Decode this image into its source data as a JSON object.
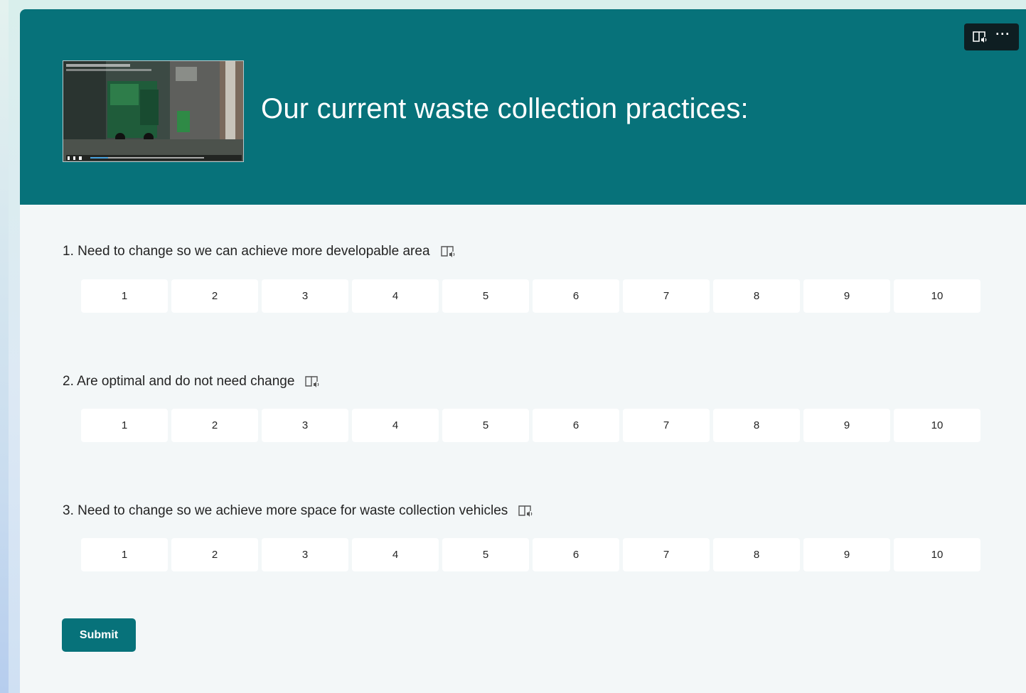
{
  "header": {
    "title": "Our current waste collection practices:",
    "background_color": "#07727a",
    "thumbnail_icon": "video-thumbnail",
    "toolbar": {
      "reader_icon": "immersive-reader-icon",
      "more_label": "···"
    }
  },
  "questions": [
    {
      "label": "1. Need to change so we can achieve more developable area",
      "scale": [
        "1",
        "2",
        "3",
        "4",
        "5",
        "6",
        "7",
        "8",
        "9",
        "10"
      ]
    },
    {
      "label": "2. Are optimal and do not need change",
      "scale": [
        "1",
        "2",
        "3",
        "4",
        "5",
        "6",
        "7",
        "8",
        "9",
        "10"
      ]
    },
    {
      "label": "3. Need to change so we achieve more space for waste collection vehicles",
      "scale": [
        "1",
        "2",
        "3",
        "4",
        "5",
        "6",
        "7",
        "8",
        "9",
        "10"
      ]
    }
  ],
  "submit_label": "Submit",
  "accent_color": "#07727a"
}
